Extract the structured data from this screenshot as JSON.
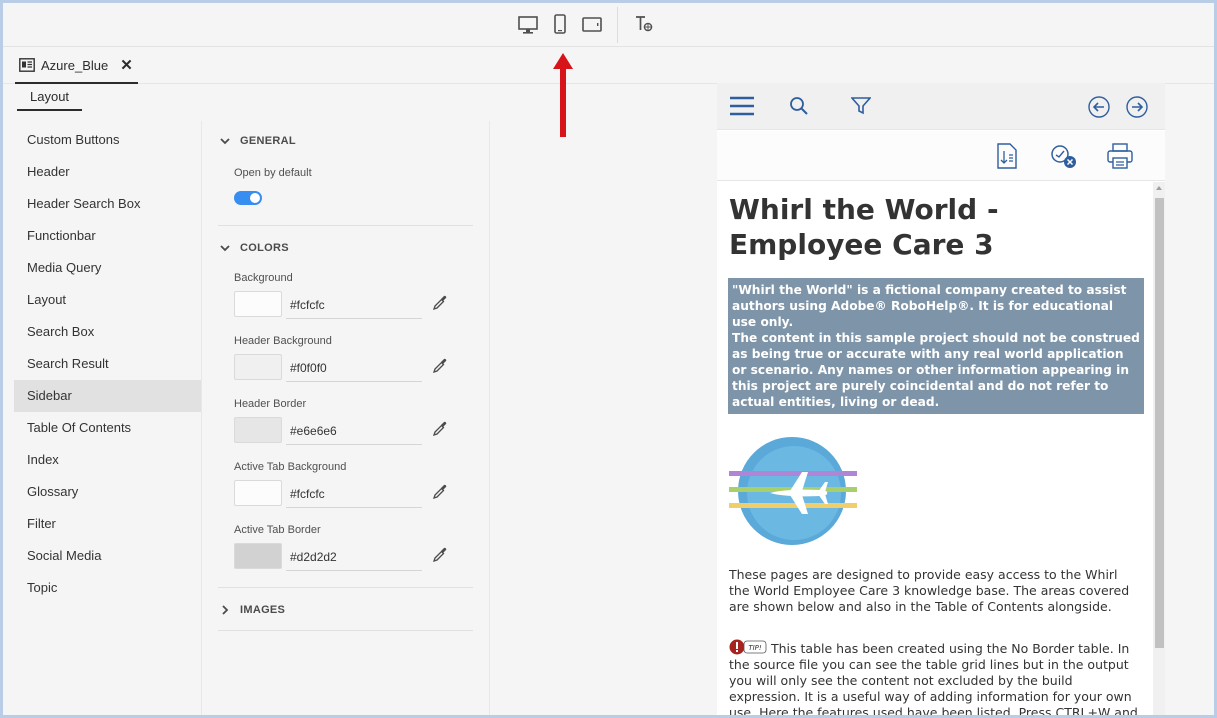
{
  "toolbar": {
    "icons": [
      "desktop-icon",
      "mobile-icon",
      "tablet-icon",
      "text-preview-icon"
    ]
  },
  "document_tab": {
    "label": "Azure_Blue",
    "close": "✕"
  },
  "subtab": {
    "label": "Layout"
  },
  "nav": {
    "items": [
      {
        "label": "Custom Buttons"
      },
      {
        "label": "Header"
      },
      {
        "label": "Header Search Box"
      },
      {
        "label": "Functionbar"
      },
      {
        "label": "Media Query"
      },
      {
        "label": "Layout"
      },
      {
        "label": "Search Box"
      },
      {
        "label": "Search Result"
      },
      {
        "label": "Sidebar",
        "active": true
      },
      {
        "label": "Table Of Contents"
      },
      {
        "label": "Index"
      },
      {
        "label": "Glossary"
      },
      {
        "label": "Filter"
      },
      {
        "label": "Social Media"
      },
      {
        "label": "Topic"
      }
    ]
  },
  "panel": {
    "general": {
      "title": "GENERAL",
      "open_by_default_label": "Open by default",
      "open_by_default": true
    },
    "colors": {
      "title": "COLORS",
      "fields": [
        {
          "label": "Background",
          "value": "#fcfcfc",
          "swatch": "#fcfcfc"
        },
        {
          "label": "Header Background",
          "value": "#f0f0f0",
          "swatch": "#f0f0f0"
        },
        {
          "label": "Header Border",
          "value": "#e6e6e6",
          "swatch": "#e6e6e6"
        },
        {
          "label": "Active Tab Background",
          "value": "#fcfcfc",
          "swatch": "#fcfcfc"
        },
        {
          "label": "Active Tab Border",
          "value": "#d2d2d2",
          "swatch": "#d2d2d2"
        }
      ]
    },
    "images": {
      "title": "IMAGES"
    }
  },
  "preview": {
    "header_icons": [
      "menu-icon",
      "search-icon",
      "filter-icon",
      "previous-icon",
      "next-icon"
    ],
    "tool_icons": [
      "expand-all-icon",
      "remove-highlight-icon",
      "print-icon"
    ],
    "title": "Whirl the World - Employee Care 3",
    "disclaimer_lines": [
      "\"Whirl the World\" is a fictional company created to assist authors using Adobe® RoboHelp®. It is for educational use only.",
      "The content in this sample project should not be construed as being true or accurate with any real world application or scenario. Any names or other information appearing in this project are purely coincidental and do not refer to actual entities, living or dead."
    ],
    "intro": "These pages are designed to provide easy access to the Whirl the World Employee Care 3 knowledge base. The areas covered are shown below and also in the Table of Contents alongside.",
    "tip_label": "TIP!",
    "tip_text": "This table has been created using the No Border table. In the source file you can see the table grid lines but in the output you will only see the content not excluded by the build expression. It is a useful way of adding information for your own use. Here the features used have been listed. Press CTRL+W and"
  },
  "colors": {
    "accent": "#378ef0",
    "annotation_arrow": "#d7141a",
    "disclaimer_bg": "#7e94a8",
    "preview_icon": "#2f5e9e"
  }
}
